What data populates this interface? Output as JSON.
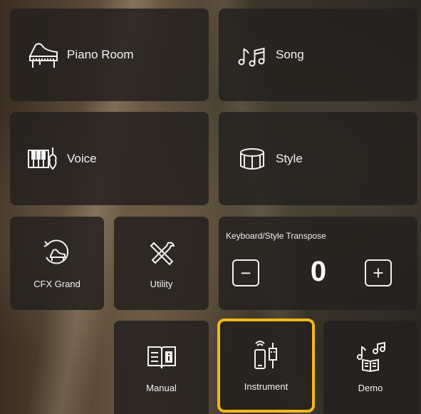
{
  "tiles": {
    "piano_room": {
      "label": "Piano Room",
      "icon": "grand-piano-icon"
    },
    "song": {
      "label": "Song",
      "icon": "music-notes-icon"
    },
    "voice": {
      "label": "Voice",
      "icon": "keyboard-violin-icon"
    },
    "style": {
      "label": "Style",
      "icon": "drum-icon"
    },
    "cfx_grand": {
      "label": "CFX Grand",
      "icon": "piano-reset-icon"
    },
    "utility": {
      "label": "Utility",
      "icon": "tools-icon"
    },
    "manual": {
      "label": "Manual",
      "icon": "book-info-icon"
    },
    "instrument": {
      "label": "Instrument",
      "icon": "usb-connection-icon",
      "selected": true
    },
    "demo": {
      "label": "Demo",
      "icon": "demo-notes-icon"
    }
  },
  "transpose": {
    "title": "Keyboard/Style Transpose",
    "value": "0",
    "minus_symbol": "−",
    "plus_symbol": "+"
  },
  "colors": {
    "tile_bg": "#24211e",
    "selected_border": "#f1b919",
    "text": "#f2f2f2"
  }
}
